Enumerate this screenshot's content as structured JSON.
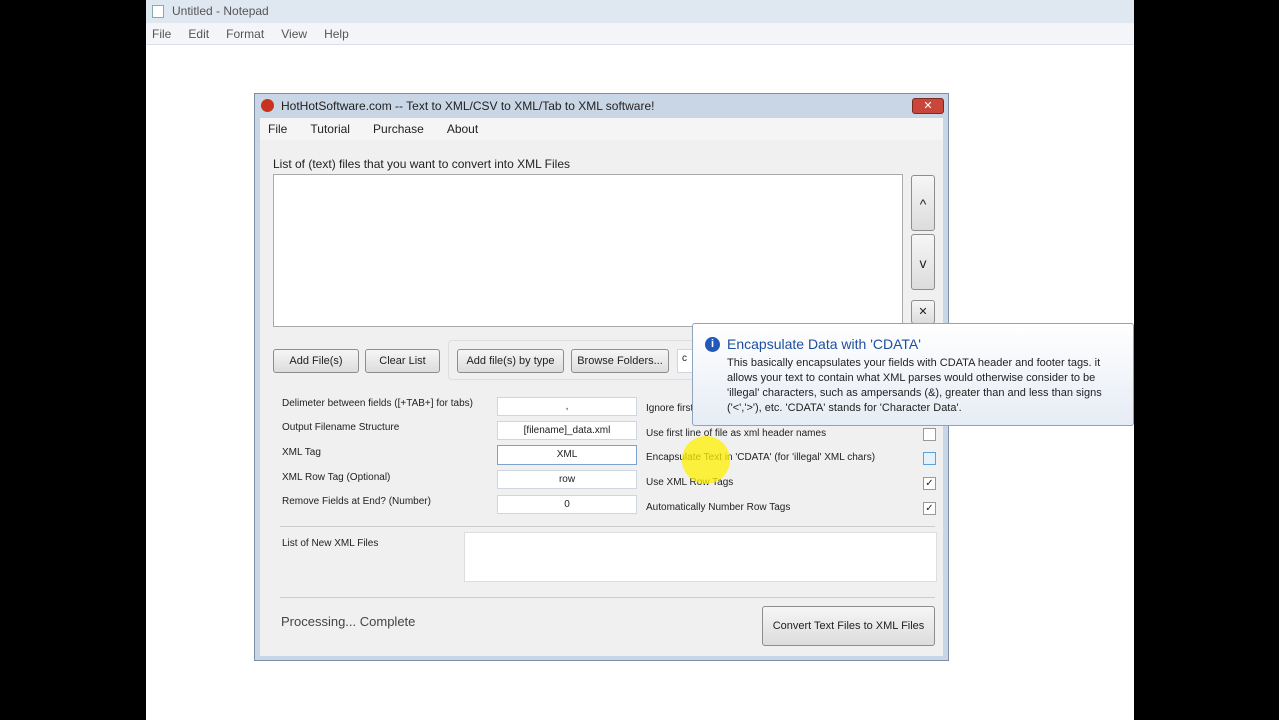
{
  "notepad": {
    "title": "Untitled - Notepad",
    "menu": [
      "File",
      "Edit",
      "Format",
      "View",
      "Help"
    ]
  },
  "dialog": {
    "title": "HotHotSoftware.com -- Text to XML/CSV to XML/Tab to XML software!",
    "close": "✕",
    "menu": [
      "File",
      "Tutorial",
      "Purchase",
      "About"
    ],
    "list_label": "List of (text) files that you want to convert into XML Files",
    "up": "^",
    "down": "v",
    "remove": "✕",
    "buttons": {
      "add_files": "Add File(s)",
      "clear_list": "Clear List",
      "add_by_type": "Add file(s) by type",
      "browse": "Browse Folders...",
      "convert": "Convert Text Files to XML Files"
    },
    "type_value": "c",
    "fields": [
      {
        "label": "Delimeter between fields ([+TAB+] for tabs)",
        "value": ","
      },
      {
        "label": "Output Filename Structure",
        "value": "[filename]_data.xml"
      },
      {
        "label": "XML Tag",
        "value": "XML"
      },
      {
        "label": "XML Row Tag (Optional)",
        "value": "row"
      },
      {
        "label": "Remove Fields at End? (Number)",
        "value": "0"
      }
    ],
    "options": [
      {
        "label": "Ignore first line",
        "checked": false
      },
      {
        "label": "Use first line of file as xml header names",
        "checked": false
      },
      {
        "label": "Encapsulate Text in 'CDATA' (for 'illegal' XML chars)",
        "checked": false
      },
      {
        "label": "Use XML Row Tags",
        "checked": true
      },
      {
        "label": "Automatically Number Row Tags",
        "checked": true
      }
    ],
    "new_files_label": "List of New XML Files",
    "status": "Processing... Complete"
  },
  "tooltip": {
    "title": "Encapsulate Data with 'CDATA'",
    "body": "This basically encapsulates your fields with CDATA header and footer tags. it allows your text to contain what XML parses would otherwise consider to be 'illegal' characters, such as ampersands (&), greater than and less than signs ('<','>'), etc. 'CDATA' stands for 'Character Data'."
  }
}
